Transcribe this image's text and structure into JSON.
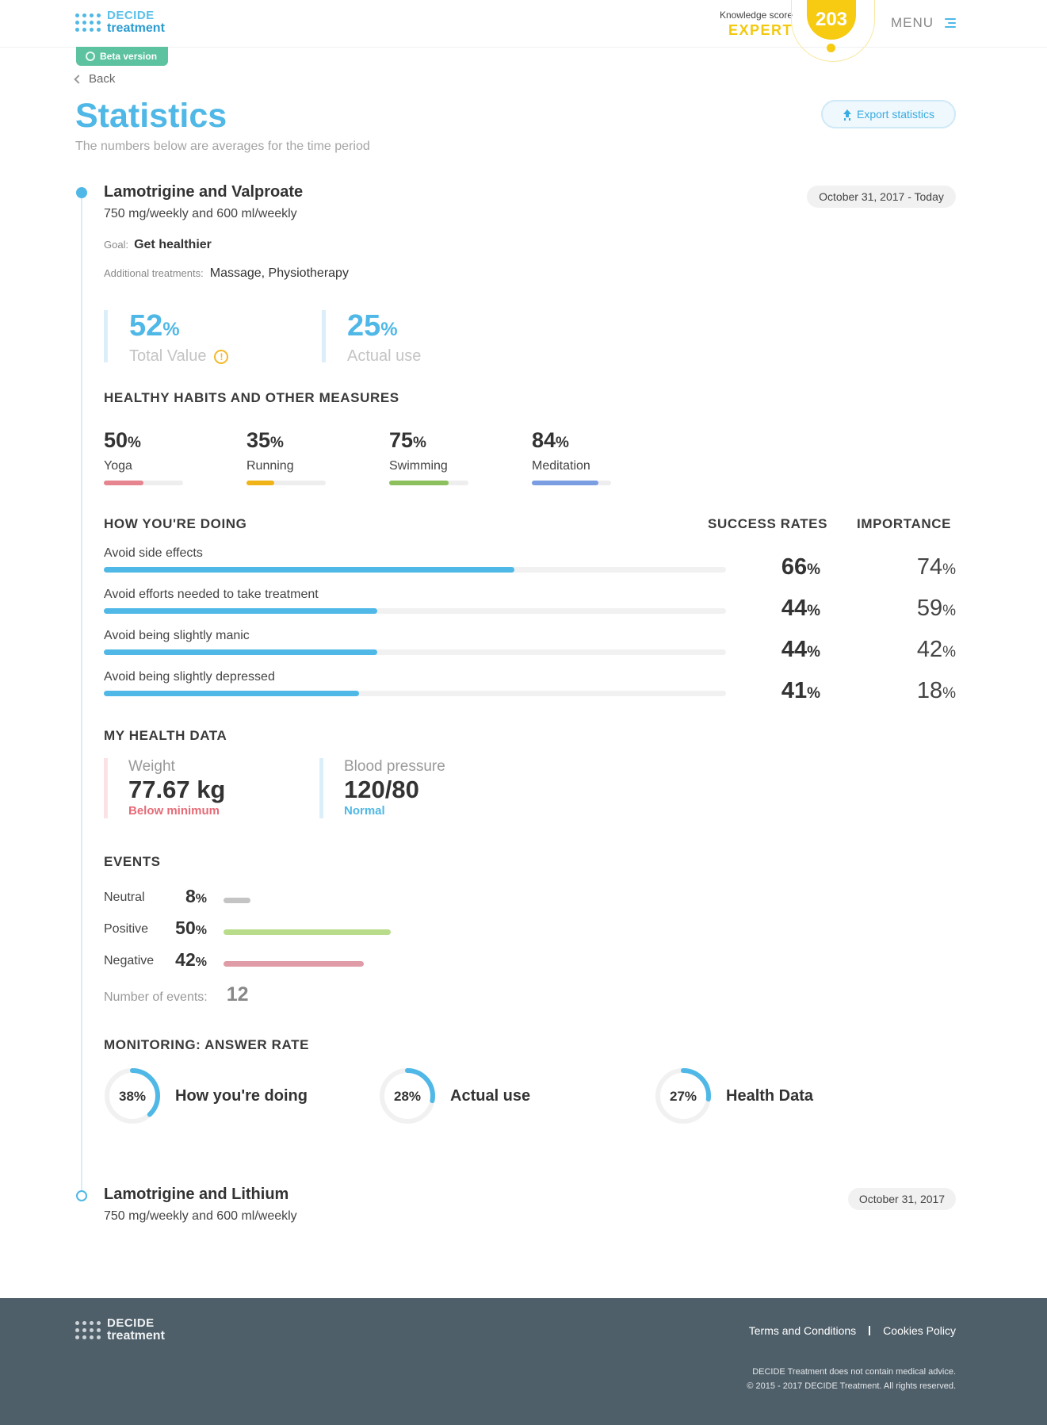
{
  "header": {
    "logo_line1": "DECIDE",
    "logo_line2": "treatment",
    "beta_label": "Beta version",
    "knowledge_label": "Knowledge score",
    "knowledge_level": "EXPERT",
    "knowledge_score": "203",
    "menu_label": "MENU"
  },
  "page": {
    "back_label": "Back",
    "title": "Statistics",
    "subtitle": "The numbers below are averages for the time period",
    "export_label": "Export statistics"
  },
  "treatment1": {
    "name": "Lamotrigine and Valproate",
    "dose": "750 mg/weekly and 600 ml/weekly",
    "date_range": "October 31, 2017 - Today",
    "goal_label": "Goal:",
    "goal_value": "Get healthier",
    "additional_label": "Additional treatments:",
    "additional_value": "Massage, Physiotherapy",
    "total_value": {
      "num": "52",
      "unit": "%",
      "label": "Total Value"
    },
    "actual_use": {
      "num": "25",
      "unit": "%",
      "label": "Actual use"
    },
    "habits_title": "HEALTHY HABITS AND OTHER MEASURES",
    "habits": [
      {
        "num": "50",
        "unit": "%",
        "label": "Yoga",
        "fraction": 0.5,
        "color": "#e6848f"
      },
      {
        "num": "35",
        "unit": "%",
        "label": "Running",
        "fraction": 0.35,
        "color": "#f0b419"
      },
      {
        "num": "75",
        "unit": "%",
        "label": "Swimming",
        "fraction": 0.75,
        "color": "#8bc05c"
      },
      {
        "num": "84",
        "unit": "%",
        "label": "Meditation",
        "fraction": 0.84,
        "color": "#7b9ee2"
      }
    ],
    "doing_title": "HOW YOU'RE DOING",
    "success_title": "SUCCESS RATES",
    "importance_title": "IMPORTANCE",
    "doing": [
      {
        "label": "Avoid side effects",
        "success": "66",
        "importance": "74",
        "unit": "%",
        "fraction": 0.66
      },
      {
        "label": "Avoid efforts needed to take treatment",
        "success": "44",
        "importance": "59",
        "unit": "%",
        "fraction": 0.44
      },
      {
        "label": "Avoid being slightly manic",
        "success": "44",
        "importance": "42",
        "unit": "%",
        "fraction": 0.44
      },
      {
        "label": "Avoid being slightly depressed",
        "success": "41",
        "importance": "18",
        "unit": "%",
        "fraction": 0.41
      }
    ],
    "health_title": "MY HEALTH DATA",
    "weight": {
      "label": "Weight",
      "value": "77.67 kg",
      "status": "Below minimum",
      "status_color": "#e56b77",
      "border_color": "#fbe2e4"
    },
    "blood_pressure": {
      "label": "Blood pressure",
      "value": "120/80",
      "status": "Normal",
      "status_color": "#4fb8e6",
      "border_color": "#dceefa"
    },
    "events_title": "EVENTS",
    "events": [
      {
        "label": "Neutral",
        "num": "8",
        "unit": "%",
        "fraction": 0.08,
        "color": "#c4c4c4"
      },
      {
        "label": "Positive",
        "num": "50",
        "unit": "%",
        "fraction": 0.5,
        "color": "#b9dc8a"
      },
      {
        "label": "Negative",
        "num": "42",
        "unit": "%",
        "fraction": 0.42,
        "color": "#df9ca6"
      }
    ],
    "num_events_label": "Number of events:",
    "num_events_value": "12",
    "monitoring_title": "MONITORING: ANSWER RATE",
    "monitoring": [
      {
        "pct": "38%",
        "fraction": 0.38,
        "label": "How you're doing"
      },
      {
        "pct": "28%",
        "fraction": 0.28,
        "label": "Actual use"
      },
      {
        "pct": "27%",
        "fraction": 0.27,
        "label": "Health Data"
      }
    ]
  },
  "treatment2": {
    "name": "Lamotrigine and Lithium",
    "dose": "750 mg/weekly and 600 ml/weekly",
    "date": "October 31, 2017"
  },
  "footer": {
    "logo_line1": "DECIDE",
    "logo_line2": "treatment",
    "terms_label": "Terms and Conditions",
    "cookies_label": "Cookies Policy",
    "note1": "DECIDE Treatment does not contain medical advice.",
    "note2": "© 2015 - 2017 DECIDE Treatment. All rights reserved."
  },
  "colors": {
    "accent": "#4fb8e6",
    "score_yellow": "#f6cb12",
    "beta_green": "#5dc2a0",
    "footer_bg": "#4f5f69"
  }
}
